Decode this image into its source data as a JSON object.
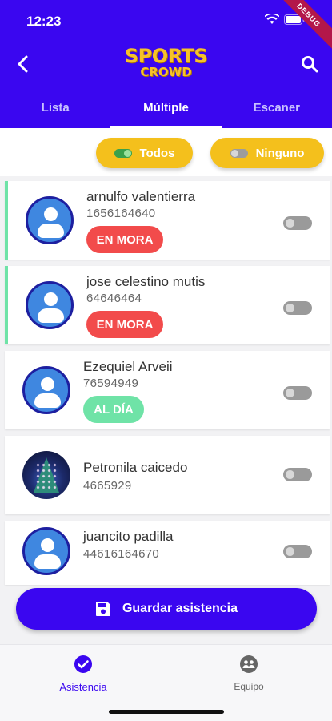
{
  "status_bar": {
    "time": "12:23",
    "debug_banner": "DEBUG"
  },
  "header": {
    "logo_line1": "SPORTS",
    "logo_line2": "CROWD",
    "back_icon": "chevron-left-icon",
    "search_icon": "search-icon",
    "tabs": [
      {
        "label": "Lista",
        "active": false
      },
      {
        "label": "Múltiple",
        "active": true
      },
      {
        "label": "Escaner",
        "active": false
      }
    ]
  },
  "filters": {
    "all_label": "Todos",
    "none_label": "Ninguno"
  },
  "members": [
    {
      "name": "arnulfo valentierra",
      "id": "1656164640",
      "status": "EN MORA",
      "status_color": "#f24b4b",
      "avatar": "default",
      "selected": false
    },
    {
      "name": "jose celestino mutis",
      "id": "64646464",
      "status": "EN MORA",
      "status_color": "#f24b4b",
      "avatar": "default",
      "selected": false
    },
    {
      "name": "Ezequiel Arveii",
      "id": "76594949",
      "status": "AL DÍA",
      "status_color": "#6fe3a7",
      "avatar": "default",
      "selected": false
    },
    {
      "name": "Petronila caicedo",
      "id": "4665929",
      "status": "",
      "avatar": "photo",
      "selected": false
    },
    {
      "name": "juancito padilla",
      "id": "44616164670",
      "status": "",
      "avatar": "default",
      "selected": false
    }
  ],
  "save_button": {
    "label": "Guardar asistencia",
    "icon": "floppy-disk-icon"
  },
  "bottom_nav": [
    {
      "label": "Asistencia",
      "icon": "check-circle-icon",
      "active": true
    },
    {
      "label": "Equipo",
      "icon": "team-icon",
      "active": false
    }
  ],
  "colors": {
    "primary": "#3a06f0",
    "accent": "#f4c01c",
    "danger": "#f24b4b",
    "success": "#6fe3a7"
  }
}
